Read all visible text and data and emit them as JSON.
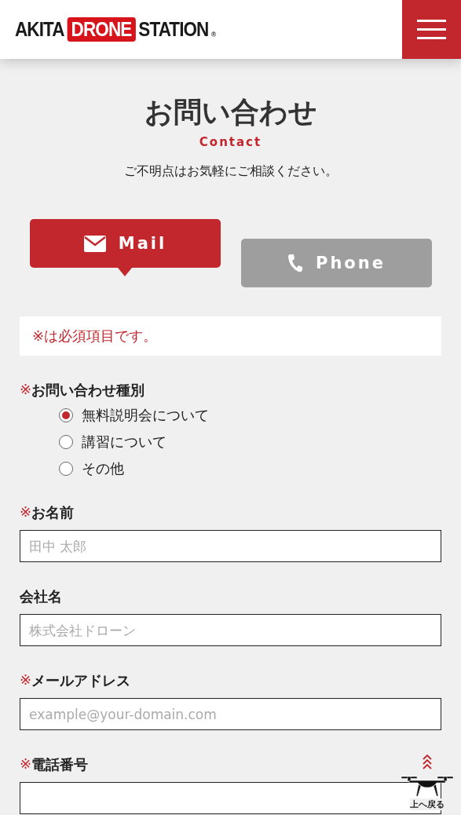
{
  "header": {
    "logo": {
      "part_1": "AKITA",
      "part_2": "DRONE",
      "part_3": "STATION",
      "mark": "®"
    }
  },
  "heading": {
    "title": "お問い合わせ",
    "subtitle": "Contact",
    "lead": "ご不明点はお気軽にご相談ください。"
  },
  "tabs": [
    {
      "kind": "mail",
      "label": "Mail",
      "selected": true
    },
    {
      "kind": "phone",
      "label": "Phone",
      "selected": false
    }
  ],
  "notice": "※は必須項目です。",
  "form": [
    {
      "kind": "radio",
      "required_mark": "※",
      "label": "お問い合わせ種別",
      "options": [
        {
          "label": "無料説明会について",
          "selected": true
        },
        {
          "label": "講習について",
          "selected": false
        },
        {
          "label": "その他",
          "selected": false
        }
      ]
    },
    {
      "kind": "text",
      "required_mark": "※",
      "label": "お名前",
      "placeholder": "田中 太郎"
    },
    {
      "kind": "text",
      "label": "会社名",
      "placeholder": "株式会社ドローン"
    },
    {
      "kind": "text",
      "required_mark": "※",
      "label": "メールアドレス",
      "placeholder": "example@your-domain.com"
    },
    {
      "kind": "text",
      "required_mark": "※",
      "label": "電話番号"
    }
  ],
  "back_to_top": {
    "label": "上へ戻る"
  }
}
